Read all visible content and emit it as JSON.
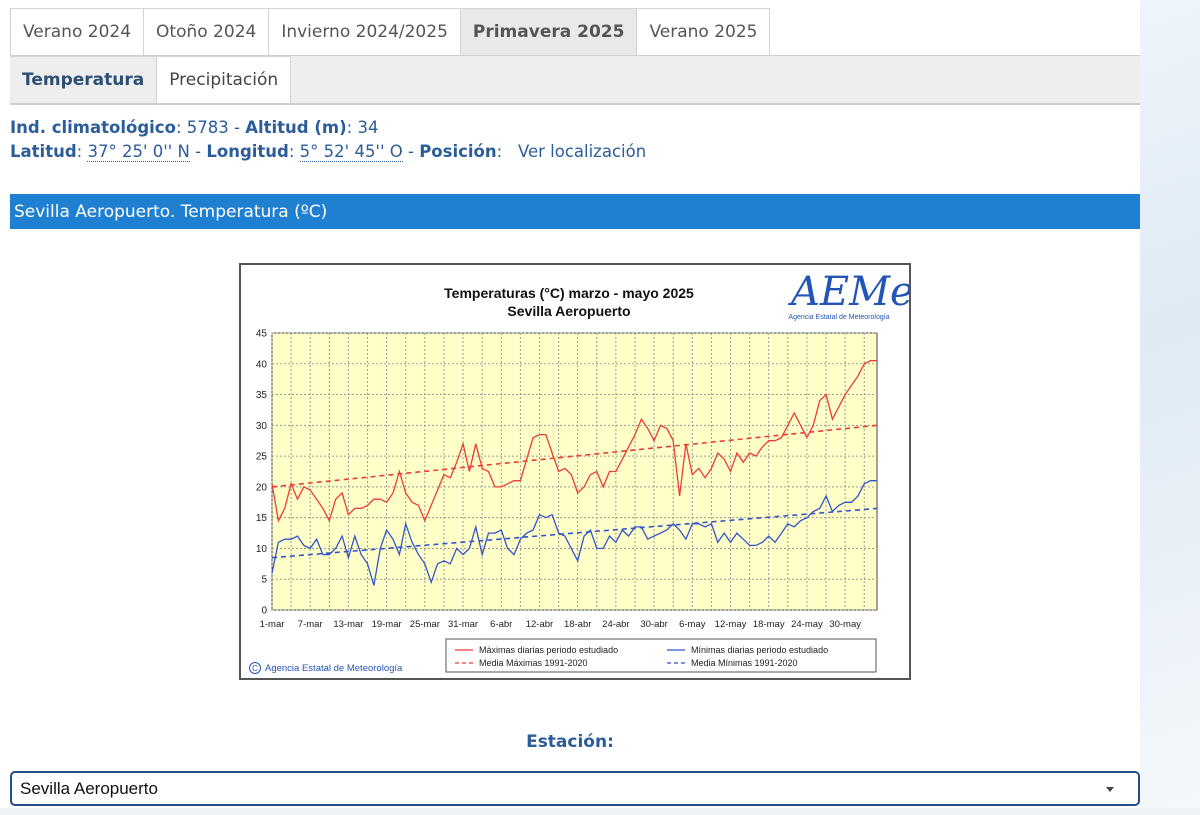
{
  "season_tabs": [
    "Verano 2024",
    "Otoño 2024",
    "Invierno 2024/2025",
    "Primavera 2025",
    "Verano 2025"
  ],
  "season_active": "Primavera 2025",
  "variable_tabs": [
    "Temperatura",
    "Precipitación"
  ],
  "variable_active": "Temperatura",
  "info": {
    "ind_label": "Ind. climatológico",
    "ind_value": "5783",
    "alt_label": "Altitud (m)",
    "alt_value": "34",
    "lat_label": "Latitud",
    "lat_value": "37° 25' 0'' N",
    "lon_label": "Longitud",
    "lon_value": "5° 52' 45'' O",
    "pos_label": "Posición",
    "pos_link": "Ver localización"
  },
  "section_title": "Sevilla Aeropuerto. Temperatura (ºC)",
  "station": {
    "label": "Estación:",
    "selected": "Sevilla Aeropuerto"
  },
  "colors": {
    "max": "#ee3b3b",
    "min": "#3355cc",
    "plot_bg": "#ffffc8",
    "header": "#1f7fd1"
  },
  "chart_data": {
    "type": "line",
    "title": "Temperaturas (°C) marzo  - mayo 2025",
    "subtitle": "Sevilla Aeropuerto",
    "logo": "AEMet",
    "logo_caption": "Agencia Estatal de Meteorología",
    "copyright": "Agencia Estatal de Meteorología",
    "ylim": [
      0,
      45
    ],
    "yticks": [
      0,
      5,
      10,
      15,
      20,
      25,
      30,
      35,
      40,
      45
    ],
    "x_tick_labels": [
      "1-mar",
      "7-mar",
      "13-mar",
      "19-mar",
      "25-mar",
      "31-mar",
      "6-abr",
      "12-abr",
      "18-abr",
      "24-abr",
      "30-abr",
      "6-may",
      "12-may",
      "18-may",
      "24-may",
      "30-may"
    ],
    "grid": true,
    "legend_position": "bottom",
    "series": [
      {
        "name": "Máximas diarias periodo estudiado",
        "style": "solid",
        "color": "#ee3b3b",
        "values": [
          20.5,
          14.5,
          16.5,
          20.5,
          18.0,
          20.0,
          19.5,
          18.0,
          16.5,
          14.5,
          18.0,
          19.0,
          15.5,
          16.5,
          16.5,
          17.0,
          18.0,
          18.0,
          17.5,
          19.0,
          22.5,
          19.0,
          17.5,
          17.0,
          14.5,
          17.0,
          19.5,
          22.0,
          21.5,
          24.0,
          27.0,
          22.5,
          27.0,
          23.0,
          22.5,
          20.0,
          20.0,
          20.5,
          21.0,
          21.0,
          24.5,
          28.0,
          28.5,
          28.5,
          25.5,
          22.5,
          23.0,
          22.0,
          19.0,
          20.0,
          22.0,
          22.5,
          20.0,
          22.5,
          22.5,
          24.5,
          26.5,
          28.5,
          31.0,
          29.5,
          27.5,
          30.0,
          29.5,
          27.5,
          18.5,
          27.0,
          22.0,
          23.0,
          21.5,
          23.0,
          25.5,
          24.5,
          22.5,
          25.5,
          24.0,
          25.5,
          25.0,
          26.5,
          27.5,
          27.5,
          28.0,
          30.0,
          32.0,
          30.0,
          28.0,
          30.0,
          34.0,
          35.0,
          31.0,
          33.0,
          35.0,
          36.5,
          38.0,
          40.0,
          40.5,
          40.5
        ]
      },
      {
        "name": "Media Máximas 1991-2020",
        "style": "dashed",
        "color": "#ee3b3b",
        "values": [
          20.0,
          30.0
        ]
      },
      {
        "name": "Mínimas diarias periodo estudiado",
        "style": "solid",
        "color": "#3355cc",
        "values": [
          6.0,
          11.0,
          11.5,
          11.5,
          12.0,
          10.5,
          10.0,
          11.5,
          9.0,
          9.0,
          10.0,
          12.0,
          8.5,
          12.0,
          9.0,
          7.5,
          4.0,
          10.0,
          13.0,
          11.5,
          9.0,
          14.0,
          11.0,
          9.0,
          7.5,
          4.5,
          7.5,
          8.0,
          7.5,
          10.0,
          9.0,
          10.0,
          13.5,
          9.0,
          12.5,
          12.5,
          13.0,
          10.0,
          9.0,
          11.5,
          12.5,
          13.0,
          15.5,
          15.0,
          15.5,
          12.5,
          12.0,
          10.0,
          8.0,
          12.0,
          13.0,
          10.0,
          10.0,
          12.0,
          11.0,
          13.0,
          12.0,
          13.5,
          13.5,
          11.5,
          12.0,
          12.5,
          13.0,
          14.0,
          13.0,
          11.5,
          14.0,
          14.0,
          13.5,
          14.0,
          11.0,
          12.5,
          11.0,
          12.5,
          11.5,
          10.5,
          10.5,
          11.0,
          12.0,
          11.0,
          12.5,
          14.0,
          13.5,
          14.5,
          15.0,
          16.0,
          16.5,
          18.5,
          16.0,
          17.0,
          17.5,
          17.5,
          18.5,
          20.5,
          21.0,
          21.0
        ]
      },
      {
        "name": "Media Mínimas 1991-2020",
        "style": "dashed",
        "color": "#3355cc",
        "values": [
          8.5,
          16.5
        ]
      }
    ]
  }
}
